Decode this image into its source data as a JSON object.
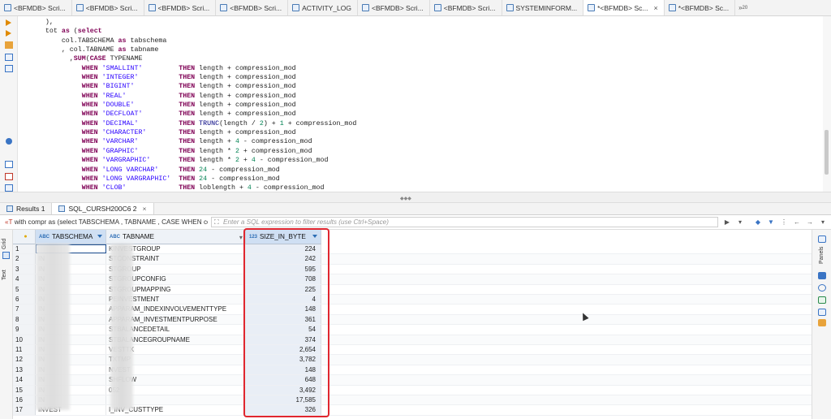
{
  "tabs": [
    {
      "label": "<BFMDB> Scri..."
    },
    {
      "label": "<BFMDB> Scri..."
    },
    {
      "label": "<BFMDB> Scri..."
    },
    {
      "label": "<BFMDB> Scri..."
    },
    {
      "label": "ACTIVITY_LOG"
    },
    {
      "label": "<BFMDB> Scri..."
    },
    {
      "label": "<BFMDB> Scri..."
    },
    {
      "label": "SYSTEMINFORM..."
    },
    {
      "label": "*<BFMDB> Sc..."
    },
    {
      "label": "*<BFMDB> Sc..."
    }
  ],
  "tabs_overflow": "»",
  "tabs_overflow_count": "20",
  "active_tab_index": 8,
  "code_lines": [
    "    ),",
    "    tot as (select",
    "        col.TABSCHEMA as tabschema",
    "        , col.TABNAME as tabname",
    "          ,SUM(CASE TYPENAME",
    "             WHEN 'SMALLINT'         THEN length + compression_mod",
    "             WHEN 'INTEGER'          THEN length + compression_mod",
    "             WHEN 'BIGINT'           THEN length + compression_mod",
    "             WHEN 'REAL'             THEN length + compression_mod",
    "             WHEN 'DOUBLE'           THEN length + compression_mod",
    "             WHEN 'DECFLOAT'         THEN length + compression_mod",
    "             WHEN 'DECIMAL'          THEN TRUNC(length / 2) + 1 + compression_mod",
    "             WHEN 'CHARACTER'        THEN length + compression_mod",
    "             WHEN 'VARCHAR'          THEN length + 4 - compression_mod",
    "             WHEN 'GRAPHIC'          THEN length * 2 + compression_mod",
    "             WHEN 'VARGRAPHIC'       THEN length * 2 + 4 - compression_mod",
    "             WHEN 'LONG VARCHAR'     THEN 24 - compression_mod",
    "             WHEN 'LONG VARGRAPHIC'  THEN 24 - compression_mod",
    "             WHEN 'CLOB'             THEN loblength + 4 - compression_mod"
  ],
  "result_tabs": [
    {
      "label": "Results 1"
    },
    {
      "label": "SQL_CURSH200C6 2"
    }
  ],
  "filter": {
    "query": "with compr as (select TABSCHEMA , TABNAME , CASE WHEN comp",
    "placeholder": "Enter a SQL expression to filter results (use Ctrl+Space)"
  },
  "side_labels": {
    "grid": "Grid",
    "text": "Text",
    "panels": "Panels"
  },
  "columns": [
    {
      "type": "ABC",
      "label": "TABSCHEMA"
    },
    {
      "type": "ABC",
      "label": "TABNAME"
    },
    {
      "type": "123",
      "label": "SIZE_IN_BYTE"
    }
  ],
  "rows": [
    {
      "n": "1",
      "schema": "",
      "name": "KINVESTGROUP",
      "size": "224"
    },
    {
      "n": "2",
      "schema": "IN",
      "name": "STCONSTRAINT",
      "size": "242"
    },
    {
      "n": "3",
      "schema": "IN",
      "name": "STGROUP",
      "size": "595"
    },
    {
      "n": "4",
      "schema": "IN",
      "name": "STGROUPCONFIG",
      "size": "708"
    },
    {
      "n": "5",
      "schema": "IN",
      "name": "STGROUPMAPPING",
      "size": "225"
    },
    {
      "n": "6",
      "schema": "IN",
      "name": "PEINVESTMENT",
      "size": "4"
    },
    {
      "n": "7",
      "schema": "IN",
      "name": "APPARAM_INDEXINVOLVEMENTTYPE",
      "size": "148"
    },
    {
      "n": "8",
      "schema": "IN",
      "name": "APPARAM_INVESTMENTPURPOSE",
      "size": "361"
    },
    {
      "n": "9",
      "schema": "IN",
      "name": "STBALANCEDETAIL",
      "size": "54"
    },
    {
      "n": "10",
      "schema": "IN",
      "name": "STBALANCEGROUPNAME",
      "size": "374"
    },
    {
      "n": "11",
      "schema": "IN",
      "name": "VESTTX",
      "size": "2,654"
    },
    {
      "n": "12",
      "schema": "IN",
      "name": "TXTMP",
      "size": "3,782"
    },
    {
      "n": "13",
      "schema": "IN",
      "name": "NVEST",
      "size": "148"
    },
    {
      "n": "14",
      "schema": "IN",
      "name": "SHFLOW",
      "size": "648"
    },
    {
      "n": "15",
      "schema": "IN",
      "name": "052",
      "size": "3,492"
    },
    {
      "n": "16",
      "schema": "IN",
      "name": "",
      "size": "17,585"
    },
    {
      "n": "17",
      "schema": "INVEST",
      "name": "I_INV_CUSTTYPE",
      "size": "326"
    }
  ]
}
